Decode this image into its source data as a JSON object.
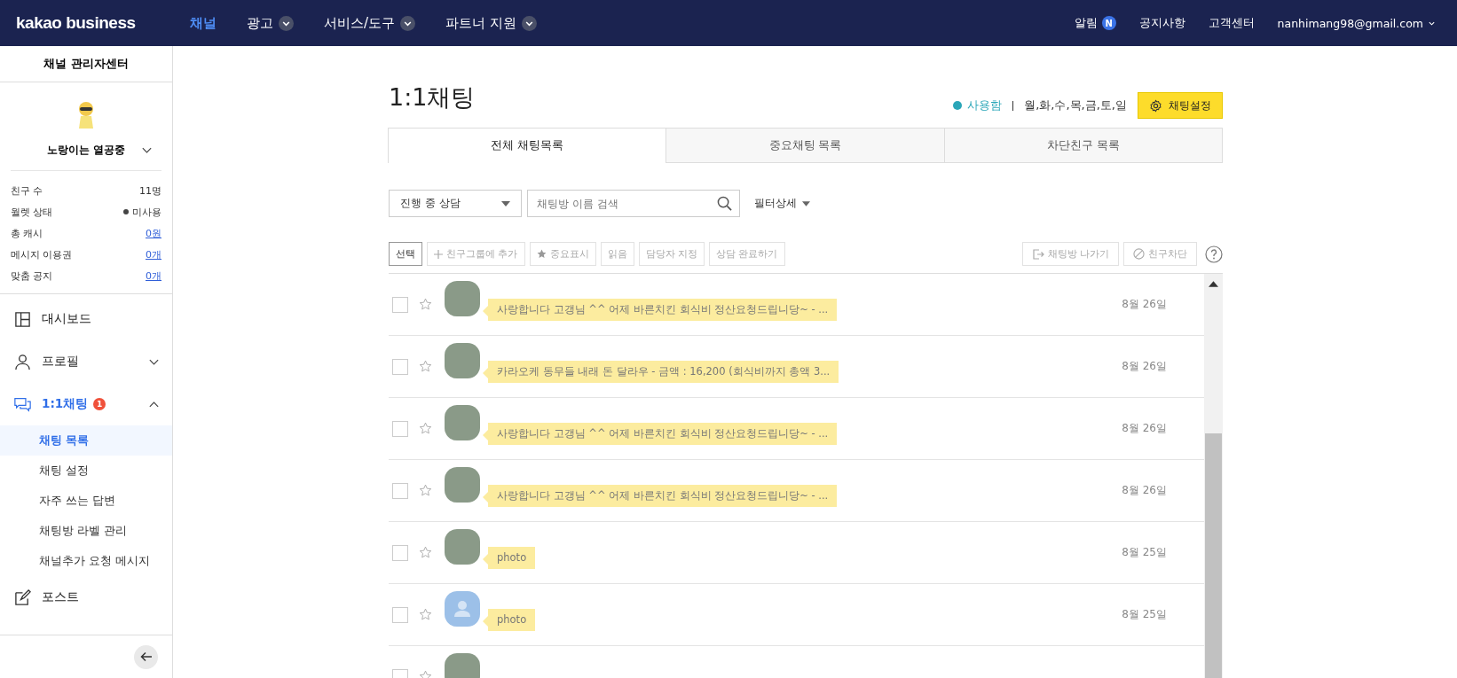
{
  "topbar": {
    "logo": "kakao business",
    "menu": [
      {
        "label": "채널",
        "selected": true,
        "dropdown": false
      },
      {
        "label": "광고",
        "selected": false,
        "dropdown": true
      },
      {
        "label": "서비스/도구",
        "selected": false,
        "dropdown": true
      },
      {
        "label": "파트너 지원",
        "selected": false,
        "dropdown": true
      }
    ],
    "alerts": {
      "label": "알림",
      "badge": "N"
    },
    "links": [
      "공지사항",
      "고객센터"
    ],
    "account": "nanhimang98@gmail.com"
  },
  "sidebar": {
    "title": "채널 관리자센터",
    "channel_name": "노랑이는 열공중",
    "stats": [
      {
        "label": "친구 수",
        "value": "11명",
        "kind": "plain"
      },
      {
        "label": "월렛 상태",
        "value": "미사용",
        "kind": "status"
      },
      {
        "label": "총 캐시",
        "value": "0원",
        "kind": "link"
      },
      {
        "label": "메시지 이용권",
        "value": "0개",
        "kind": "link"
      },
      {
        "label": "맞춤 공지",
        "value": "0개",
        "kind": "link"
      }
    ],
    "nav": [
      {
        "label": "대시보드",
        "selected": false,
        "expandable": false
      },
      {
        "label": "프로필",
        "selected": false,
        "expandable": true,
        "expanded": false
      },
      {
        "label": "1:1채팅",
        "badge": "1",
        "selected": true,
        "expandable": true,
        "expanded": true,
        "children": [
          {
            "label": "채팅 목록",
            "selected": true
          },
          {
            "label": "채팅 설정",
            "selected": false
          },
          {
            "label": "자주 쓰는 답변",
            "selected": false
          },
          {
            "label": "채팅방 라벨 관리",
            "selected": false
          },
          {
            "label": "채널추가 요청 메시지",
            "selected": false
          }
        ]
      },
      {
        "label": "포스트",
        "selected": false,
        "expandable": false
      }
    ]
  },
  "main": {
    "title": "1:1채팅",
    "status": {
      "label": "사용함",
      "on": true
    },
    "days": "월,화,수,목,금,토,일",
    "settings_button": "채팅설정",
    "tabs": [
      {
        "label": "전체 채팅목록",
        "selected": true
      },
      {
        "label": "중요채팅 목록",
        "selected": false
      },
      {
        "label": "차단친구 목록",
        "selected": false
      }
    ],
    "filter_select": "진행 중 상담",
    "search": {
      "placeholder": "채팅방 이름 검색"
    },
    "filter_detail": "필터상세",
    "actions_left": [
      {
        "label": "선택",
        "disabled": false
      },
      {
        "label": "친구그룹에 추가",
        "disabled": true
      },
      {
        "label": "중요표시",
        "disabled": true
      },
      {
        "label": "읽음",
        "disabled": true
      },
      {
        "label": "담당자 지정",
        "disabled": true
      },
      {
        "label": "상담 완료하기",
        "disabled": true
      }
    ],
    "actions_right": [
      {
        "label": "채팅방 나가기",
        "disabled": true
      },
      {
        "label": "친구차단",
        "disabled": true
      }
    ],
    "chats": [
      {
        "kind": "photo",
        "message": "사랑합니다 고갱님 ^^ 어제 바른치킨 회식비 정산요청드립니당~ - ...",
        "date": "8월 26일",
        "checked": false,
        "starred": false
      },
      {
        "kind": "photo",
        "message": "카라오케 동무들 내래 돈 달라우 - 금액 : 16,200 (회식비까지 총액 3...",
        "date": "8월 26일",
        "checked": false,
        "starred": false
      },
      {
        "kind": "photo",
        "message": "사랑합니다 고갱님 ^^ 어제 바른치킨 회식비 정산요청드립니당~ - ...",
        "date": "8월 26일",
        "checked": false,
        "starred": false
      },
      {
        "kind": "photo",
        "message": "사랑합니다 고갱님 ^^ 어제 바른치킨 회식비 정산요청드립니당~ - ...",
        "date": "8월 26일",
        "checked": false,
        "starred": false
      },
      {
        "kind": "photo",
        "message": "photo",
        "date": "8월 25일",
        "checked": false,
        "starred": false
      },
      {
        "kind": "default",
        "message": "photo",
        "date": "8월 25일",
        "checked": false,
        "starred": false
      },
      {
        "kind": "photo",
        "checked": false,
        "starred": false
      }
    ]
  }
}
